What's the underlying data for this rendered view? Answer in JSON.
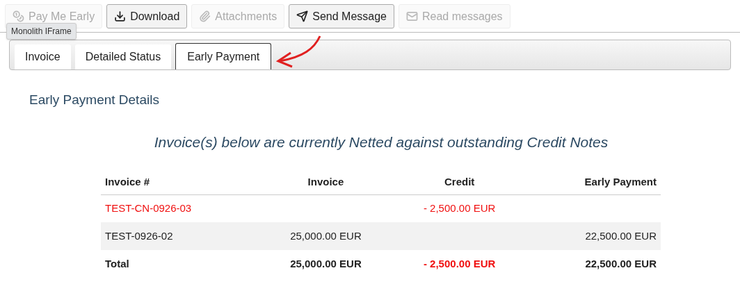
{
  "toolbar": [
    {
      "label": "Pay Me Early",
      "kind": "coins",
      "disabled": true
    },
    {
      "label": "Download",
      "kind": "download",
      "disabled": false
    },
    {
      "label": "Attachments",
      "kind": "paperclip",
      "disabled": true
    },
    {
      "label": "Send Message",
      "kind": "send",
      "disabled": false
    },
    {
      "label": "Read messages",
      "kind": "mail",
      "disabled": true
    }
  ],
  "tooltip": "Monolith IFrame",
  "tabs": [
    {
      "label": "Invoice",
      "selected": false
    },
    {
      "label": "Detailed Status",
      "selected": false
    },
    {
      "label": "Early Payment",
      "selected": true
    }
  ],
  "section_title": "Early Payment Details",
  "notice": "Invoice(s) below are currently Netted against outstanding Credit Notes",
  "table": {
    "columns": [
      "Invoice #",
      "Invoice",
      "Credit",
      "Early Payment"
    ],
    "rows": [
      {
        "kind": "credit",
        "cells": [
          "TEST-CN-0926-03",
          "",
          "- 2,500.00 EUR",
          ""
        ]
      },
      {
        "kind": "invoice",
        "cells": [
          "TEST-0926-02",
          "25,000.00 EUR",
          "",
          "22,500.00 EUR"
        ]
      },
      {
        "kind": "total",
        "cells": [
          "Total",
          "25,000.00 EUR",
          "- 2,500.00 EUR",
          "22,500.00 EUR"
        ]
      }
    ]
  }
}
